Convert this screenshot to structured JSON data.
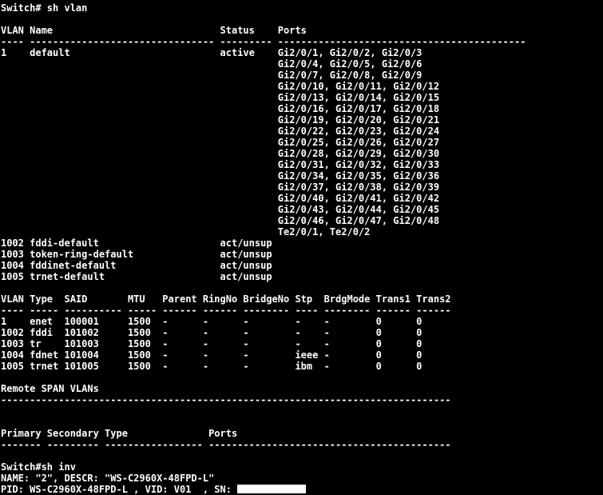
{
  "terminal": {
    "prompt_line_1": "Switch# sh vlan",
    "prompt_line_2": "Switch#sh inv",
    "colors": {
      "background": "#000000",
      "foreground": "#ffffff",
      "redaction": "#ffffff"
    }
  },
  "vlan_table": {
    "headers": [
      "VLAN",
      "Name",
      "Status",
      "Ports"
    ],
    "header_line": "VLAN Name                             Status    Ports",
    "separator_line": "---- -------------------------------- --------- -------------------------------------------",
    "rows": [
      {
        "vlan": "1",
        "name": "default",
        "status": "active",
        "ports": [
          "Gi2/0/1, Gi2/0/2, Gi2/0/3",
          "Gi2/0/4, Gi2/0/5, Gi2/0/6",
          "Gi2/0/7, Gi2/0/8, Gi2/0/9",
          "Gi2/0/10, Gi2/0/11, Gi2/0/12",
          "Gi2/0/13, Gi2/0/14, Gi2/0/15",
          "Gi2/0/16, Gi2/0/17, Gi2/0/18",
          "Gi2/0/19, Gi2/0/20, Gi2/0/21",
          "Gi2/0/22, Gi2/0/23, Gi2/0/24",
          "Gi2/0/25, Gi2/0/26, Gi2/0/27",
          "Gi2/0/28, Gi2/0/29, Gi2/0/30",
          "Gi2/0/31, Gi2/0/32, Gi2/0/33",
          "Gi2/0/34, Gi2/0/35, Gi2/0/36",
          "Gi2/0/37, Gi2/0/38, Gi2/0/39",
          "Gi2/0/40, Gi2/0/41, Gi2/0/42",
          "Gi2/0/43, Gi2/0/44, Gi2/0/45",
          "Gi2/0/46, Gi2/0/47, Gi2/0/48",
          "Te2/0/1, Te2/0/2"
        ]
      },
      {
        "vlan": "1002",
        "name": "fddi-default",
        "status": "act/unsup",
        "ports": []
      },
      {
        "vlan": "1003",
        "name": "token-ring-default",
        "status": "act/unsup",
        "ports": []
      },
      {
        "vlan": "1004",
        "name": "fddinet-default",
        "status": "act/unsup",
        "ports": []
      },
      {
        "vlan": "1005",
        "name": "trnet-default",
        "status": "act/unsup",
        "ports": []
      }
    ],
    "rendered_lines": [
      "1    default                          active    Gi2/0/1, Gi2/0/2, Gi2/0/3",
      "                                                Gi2/0/4, Gi2/0/5, Gi2/0/6",
      "                                                Gi2/0/7, Gi2/0/8, Gi2/0/9",
      "                                                Gi2/0/10, Gi2/0/11, Gi2/0/12",
      "                                                Gi2/0/13, Gi2/0/14, Gi2/0/15",
      "                                                Gi2/0/16, Gi2/0/17, Gi2/0/18",
      "                                                Gi2/0/19, Gi2/0/20, Gi2/0/21",
      "                                                Gi2/0/22, Gi2/0/23, Gi2/0/24",
      "                                                Gi2/0/25, Gi2/0/26, Gi2/0/27",
      "                                                Gi2/0/28, Gi2/0/29, Gi2/0/30",
      "                                                Gi2/0/31, Gi2/0/32, Gi2/0/33",
      "                                                Gi2/0/34, Gi2/0/35, Gi2/0/36",
      "                                                Gi2/0/37, Gi2/0/38, Gi2/0/39",
      "                                                Gi2/0/40, Gi2/0/41, Gi2/0/42",
      "                                                Gi2/0/43, Gi2/0/44, Gi2/0/45",
      "                                                Gi2/0/46, Gi2/0/47, Gi2/0/48",
      "                                                Te2/0/1, Te2/0/2",
      "1002 fddi-default                     act/unsup",
      "1003 token-ring-default               act/unsup",
      "1004 fddinet-default                  act/unsup",
      "1005 trnet-default                    act/unsup"
    ]
  },
  "vlan_detail_table": {
    "headers": [
      "VLAN",
      "Type",
      "SAID",
      "MTU",
      "Parent",
      "RingNo",
      "BridgeNo",
      "Stp",
      "BrdgMode",
      "Trans1",
      "Trans2"
    ],
    "header_line": "VLAN Type  SAID       MTU   Parent RingNo BridgeNo Stp  BrdgMode Trans1 Trans2",
    "separator_line": "---- ----- ---------- ----- ------ ------ -------- ---- -------- ------ ------",
    "rows": [
      {
        "vlan": "1",
        "type": "enet",
        "said": "100001",
        "mtu": "1500",
        "parent": "-",
        "ringno": "-",
        "bridgeno": "-",
        "stp": "-",
        "brdgmode": "-",
        "trans1": "0",
        "trans2": "0"
      },
      {
        "vlan": "1002",
        "type": "fddi",
        "said": "101002",
        "mtu": "1500",
        "parent": "-",
        "ringno": "-",
        "bridgeno": "-",
        "stp": "-",
        "brdgmode": "-",
        "trans1": "0",
        "trans2": "0"
      },
      {
        "vlan": "1003",
        "type": "tr",
        "said": "101003",
        "mtu": "1500",
        "parent": "-",
        "ringno": "-",
        "bridgeno": "-",
        "stp": "-",
        "brdgmode": "-",
        "trans1": "0",
        "trans2": "0"
      },
      {
        "vlan": "1004",
        "type": "fdnet",
        "said": "101004",
        "mtu": "1500",
        "parent": "-",
        "ringno": "-",
        "bridgeno": "-",
        "stp": "ieee",
        "brdgmode": "-",
        "trans1": "0",
        "trans2": "0"
      },
      {
        "vlan": "1005",
        "type": "trnet",
        "said": "101005",
        "mtu": "1500",
        "parent": "-",
        "ringno": "-",
        "bridgeno": "-",
        "stp": "ibm",
        "brdgmode": "-",
        "trans1": "0",
        "trans2": "0"
      }
    ],
    "rendered_lines": [
      "1    enet  100001     1500  -      -      -        -    -        0      0",
      "1002 fddi  101002     1500  -      -      -        -    -        0      0",
      "1003 tr    101003     1500  -      -      -        -    -        0      0",
      "1004 fdnet 101004     1500  -      -      -        ieee -        0      0",
      "1005 trnet 101005     1500  -      -      -        ibm  -        0      0"
    ]
  },
  "remote_span": {
    "title": "Remote SPAN VLANs",
    "separator_line": "------------------------------------------------------------------------------",
    "value": ""
  },
  "pvlan_table": {
    "headers": [
      "Primary",
      "Secondary",
      "Type",
      "Ports"
    ],
    "header_line": "Primary Secondary Type              Ports",
    "separator_line": "------- --------- ----------------- ------------------------------------------",
    "rows": []
  },
  "inventory": {
    "name_line": "NAME: \"2\", DESCR: \"WS-C2960X-48FPD-L\"",
    "pid_prefix": "PID: WS-C2960X-48FPD-L , VID: V01  , SN: ",
    "name_label": "NAME:",
    "name_value": "\"2\"",
    "descr_label": "DESCR:",
    "descr_value": "\"WS-C2960X-48FPD-L\"",
    "pid_label": "PID:",
    "pid_value": "WS-C2960X-48FPD-L",
    "vid_label": "VID:",
    "vid_value": "V01",
    "sn_label": "SN:",
    "sn_value": "[redacted]"
  }
}
